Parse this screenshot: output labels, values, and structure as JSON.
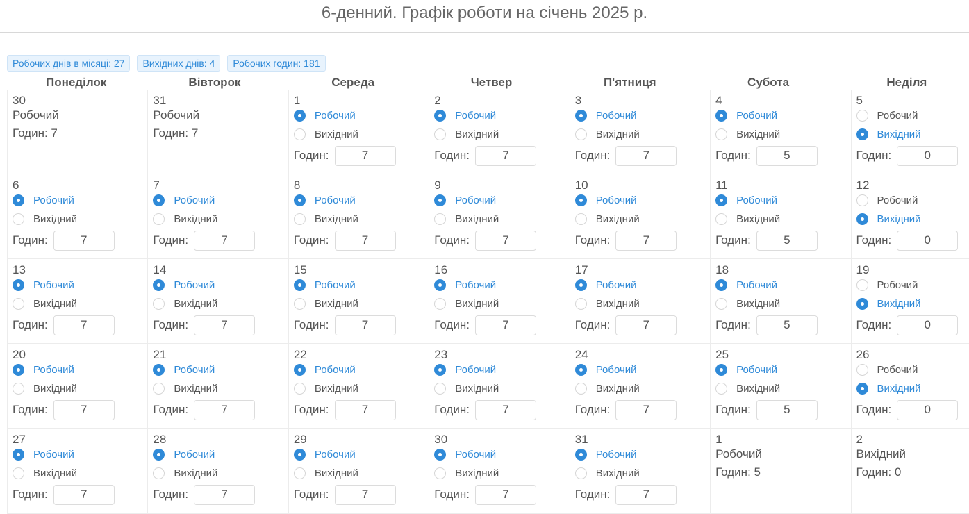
{
  "header": {
    "title": "6-денний. Графік роботи на січень 2025 р."
  },
  "summary": {
    "work_days": "Робочих днів в місяці: 27",
    "days_off": "Вихідних днів: 4",
    "work_hours": "Робочих годин: 181"
  },
  "labels": {
    "working": "Робочий",
    "day_off": "Вихідний",
    "hours": "Годин:"
  },
  "weekdays": [
    "Понеділок",
    "Вівторок",
    "Середа",
    "Четвер",
    "П'ятниця",
    "Субота",
    "Неділя"
  ],
  "colors": {
    "accent": "#2f8ad8",
    "badge_bg": "#e8f3fd"
  },
  "weeks": [
    [
      {
        "day": "30",
        "editable": false,
        "type": "working",
        "type_label": "Робочий",
        "hours_text": "Годин: 7"
      },
      {
        "day": "31",
        "editable": false,
        "type": "working",
        "type_label": "Робочий",
        "hours_text": "Годин: 7"
      },
      {
        "day": "1",
        "editable": true,
        "type": "working",
        "hours": "7"
      },
      {
        "day": "2",
        "editable": true,
        "type": "working",
        "hours": "7"
      },
      {
        "day": "3",
        "editable": true,
        "type": "working",
        "hours": "7"
      },
      {
        "day": "4",
        "editable": true,
        "type": "working",
        "hours": "5"
      },
      {
        "day": "5",
        "editable": true,
        "type": "off",
        "hours": "0"
      }
    ],
    [
      {
        "day": "6",
        "editable": true,
        "type": "working",
        "hours": "7"
      },
      {
        "day": "7",
        "editable": true,
        "type": "working",
        "hours": "7"
      },
      {
        "day": "8",
        "editable": true,
        "type": "working",
        "hours": "7"
      },
      {
        "day": "9",
        "editable": true,
        "type": "working",
        "hours": "7"
      },
      {
        "day": "10",
        "editable": true,
        "type": "working",
        "hours": "7"
      },
      {
        "day": "11",
        "editable": true,
        "type": "working",
        "hours": "5"
      },
      {
        "day": "12",
        "editable": true,
        "type": "off",
        "hours": "0"
      }
    ],
    [
      {
        "day": "13",
        "editable": true,
        "type": "working",
        "hours": "7"
      },
      {
        "day": "14",
        "editable": true,
        "type": "working",
        "hours": "7"
      },
      {
        "day": "15",
        "editable": true,
        "type": "working",
        "hours": "7"
      },
      {
        "day": "16",
        "editable": true,
        "type": "working",
        "hours": "7"
      },
      {
        "day": "17",
        "editable": true,
        "type": "working",
        "hours": "7"
      },
      {
        "day": "18",
        "editable": true,
        "type": "working",
        "hours": "5"
      },
      {
        "day": "19",
        "editable": true,
        "type": "off",
        "hours": "0"
      }
    ],
    [
      {
        "day": "20",
        "editable": true,
        "type": "working",
        "hours": "7"
      },
      {
        "day": "21",
        "editable": true,
        "type": "working",
        "hours": "7"
      },
      {
        "day": "22",
        "editable": true,
        "type": "working",
        "hours": "7"
      },
      {
        "day": "23",
        "editable": true,
        "type": "working",
        "hours": "7"
      },
      {
        "day": "24",
        "editable": true,
        "type": "working",
        "hours": "7"
      },
      {
        "day": "25",
        "editable": true,
        "type": "working",
        "hours": "5"
      },
      {
        "day": "26",
        "editable": true,
        "type": "off",
        "hours": "0"
      }
    ],
    [
      {
        "day": "27",
        "editable": true,
        "type": "working",
        "hours": "7"
      },
      {
        "day": "28",
        "editable": true,
        "type": "working",
        "hours": "7"
      },
      {
        "day": "29",
        "editable": true,
        "type": "working",
        "hours": "7"
      },
      {
        "day": "30",
        "editable": true,
        "type": "working",
        "hours": "7"
      },
      {
        "day": "31",
        "editable": true,
        "type": "working",
        "hours": "7"
      },
      {
        "day": "1",
        "editable": false,
        "type": "working",
        "type_label": "Робочий",
        "hours_text": "Годин: 5"
      },
      {
        "day": "2",
        "editable": false,
        "type": "off",
        "type_label": "Вихідний",
        "hours_text": "Годин: 0"
      }
    ]
  ]
}
